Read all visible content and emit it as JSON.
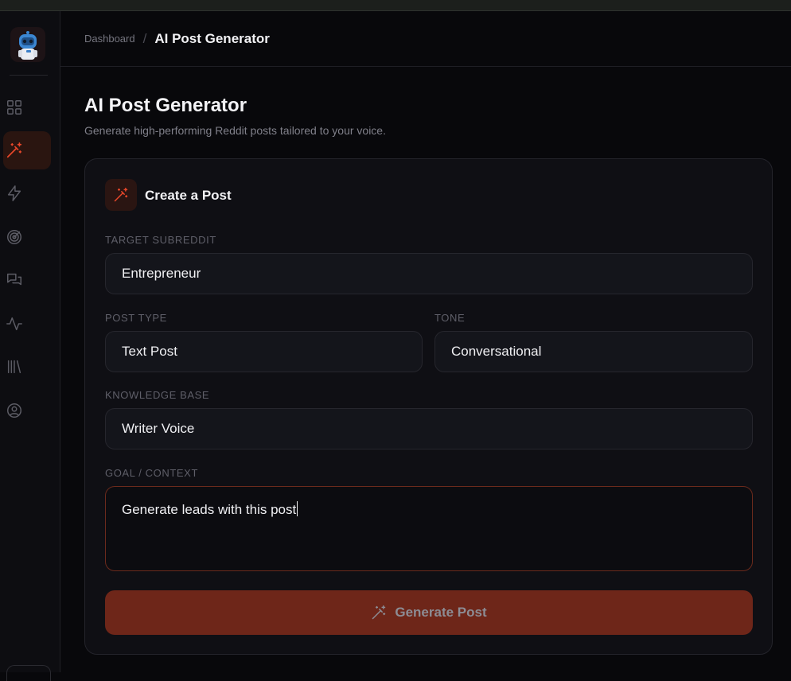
{
  "breadcrumb": {
    "parent": "Dashboard",
    "separator": "/",
    "current": "AI Post Generator"
  },
  "page": {
    "title": "AI Post Generator",
    "subtitle": "Generate high-performing Reddit posts tailored to your voice."
  },
  "card": {
    "title": "Create a Post",
    "icon": "magic-wand-icon"
  },
  "form": {
    "subreddit": {
      "label": "TARGET SUBREDDIT",
      "value": "Entrepreneur"
    },
    "post_type": {
      "label": "POST TYPE",
      "value": "Text Post"
    },
    "tone": {
      "label": "TONE",
      "value": "Conversational"
    },
    "knowledge_base": {
      "label": "KNOWLEDGE BASE",
      "value": "Writer Voice"
    },
    "goal": {
      "label": "GOAL / CONTEXT",
      "value": "Generate leads with this post"
    }
  },
  "generate_button": {
    "label": "Generate Post",
    "icon": "magic-wand-icon"
  },
  "sidebar": {
    "items": [
      {
        "icon": "grid-icon",
        "active": false
      },
      {
        "icon": "magic-wand-icon",
        "active": true
      },
      {
        "icon": "lightning-icon",
        "active": false
      },
      {
        "icon": "radar-icon",
        "active": false
      },
      {
        "icon": "chat-bubbles-icon",
        "active": false
      },
      {
        "icon": "activity-icon",
        "active": false
      },
      {
        "icon": "library-icon",
        "active": false
      },
      {
        "icon": "user-circle-icon",
        "active": false
      }
    ]
  },
  "colors": {
    "accent": "#e8472a",
    "button_bg": "#6e2619",
    "background": "#08080b",
    "card_bg": "#0f0f14"
  }
}
